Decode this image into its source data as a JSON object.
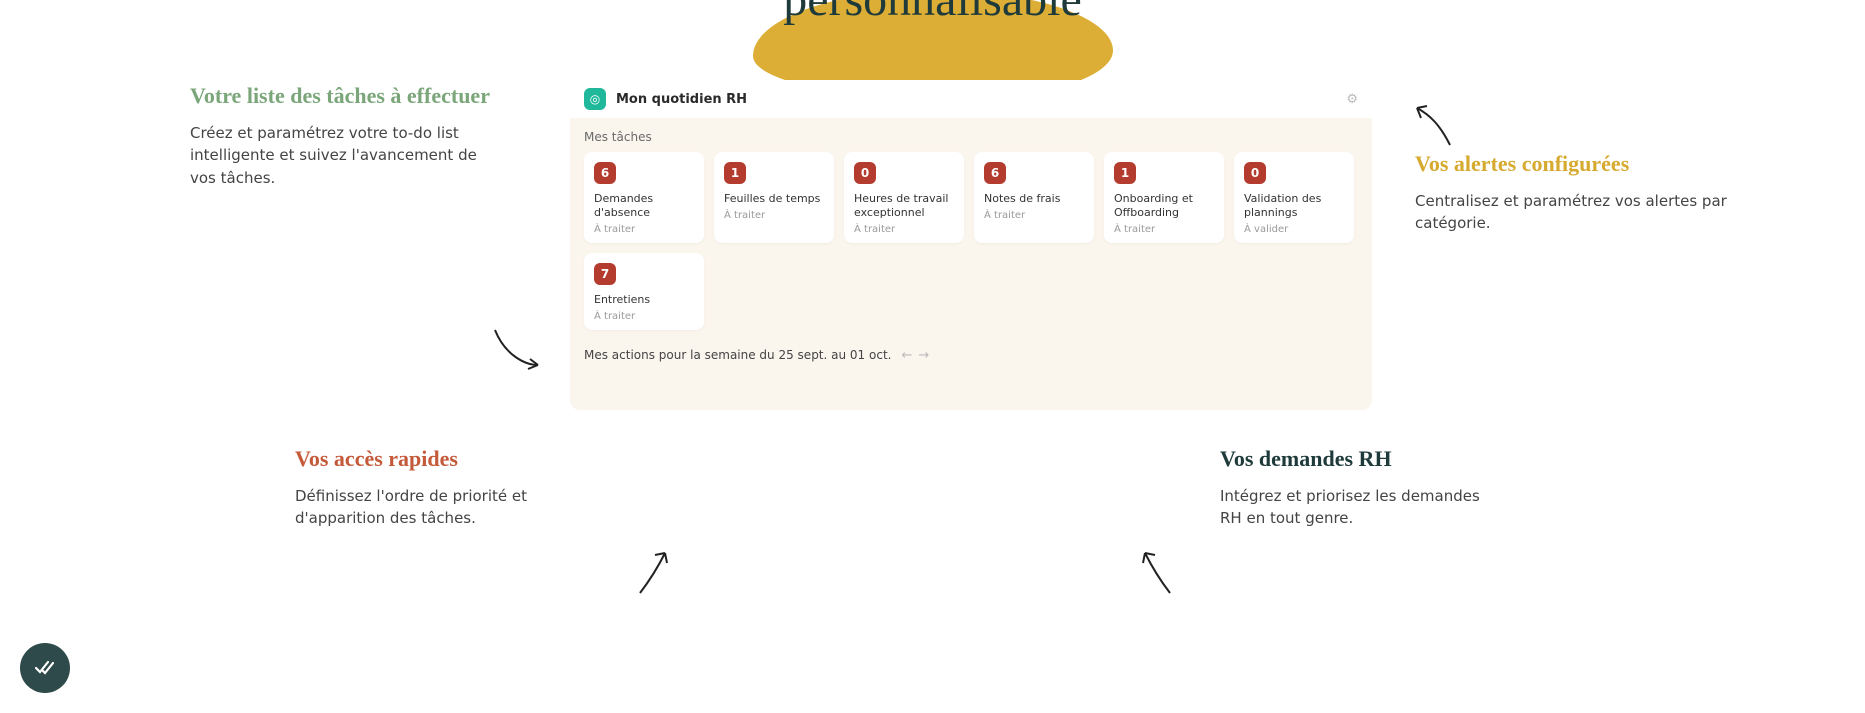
{
  "cutoff_title": "personnalisable",
  "callouts": {
    "top_left": {
      "title": "Votre liste des tâches à effectuer",
      "body": "Créez et paramétrez votre to-do list intelligente et suivez l'avancement de vos tâches."
    },
    "top_right": {
      "title": "Vos alertes configurées",
      "body": "Centralisez et paramétrez vos alertes par catégorie."
    },
    "bottom_left": {
      "title": "Vos accès rapides",
      "body": "Définissez l'ordre de priorité et d'apparition des tâches."
    },
    "bottom_right": {
      "title": "Vos demandes RH",
      "body": "Intégrez et priorisez les demandes RH en tout genre."
    }
  },
  "panel": {
    "title": "Mon quotidien RH",
    "tasks_label": "Mes tâches",
    "actions_label": "Mes actions pour la semaine du 25 sept. au 01 oct.",
    "cards": [
      {
        "count": "6",
        "title": "Demandes d'absence",
        "sub": "À traiter"
      },
      {
        "count": "1",
        "title": "Feuilles de temps",
        "sub": "À traiter"
      },
      {
        "count": "0",
        "title": "Heures de travail exceptionnel",
        "sub": "À traiter"
      },
      {
        "count": "6",
        "title": "Notes de frais",
        "sub": "À traiter"
      },
      {
        "count": "1",
        "title": "Onboarding et Offboarding",
        "sub": "À traiter"
      },
      {
        "count": "0",
        "title": "Validation des plannings",
        "sub": "À valider"
      },
      {
        "count": "7",
        "title": "Entretiens",
        "sub": "À traiter"
      }
    ]
  },
  "icons": {
    "logo": "◎",
    "gear": "⚙",
    "prev": "←",
    "next": "→"
  }
}
